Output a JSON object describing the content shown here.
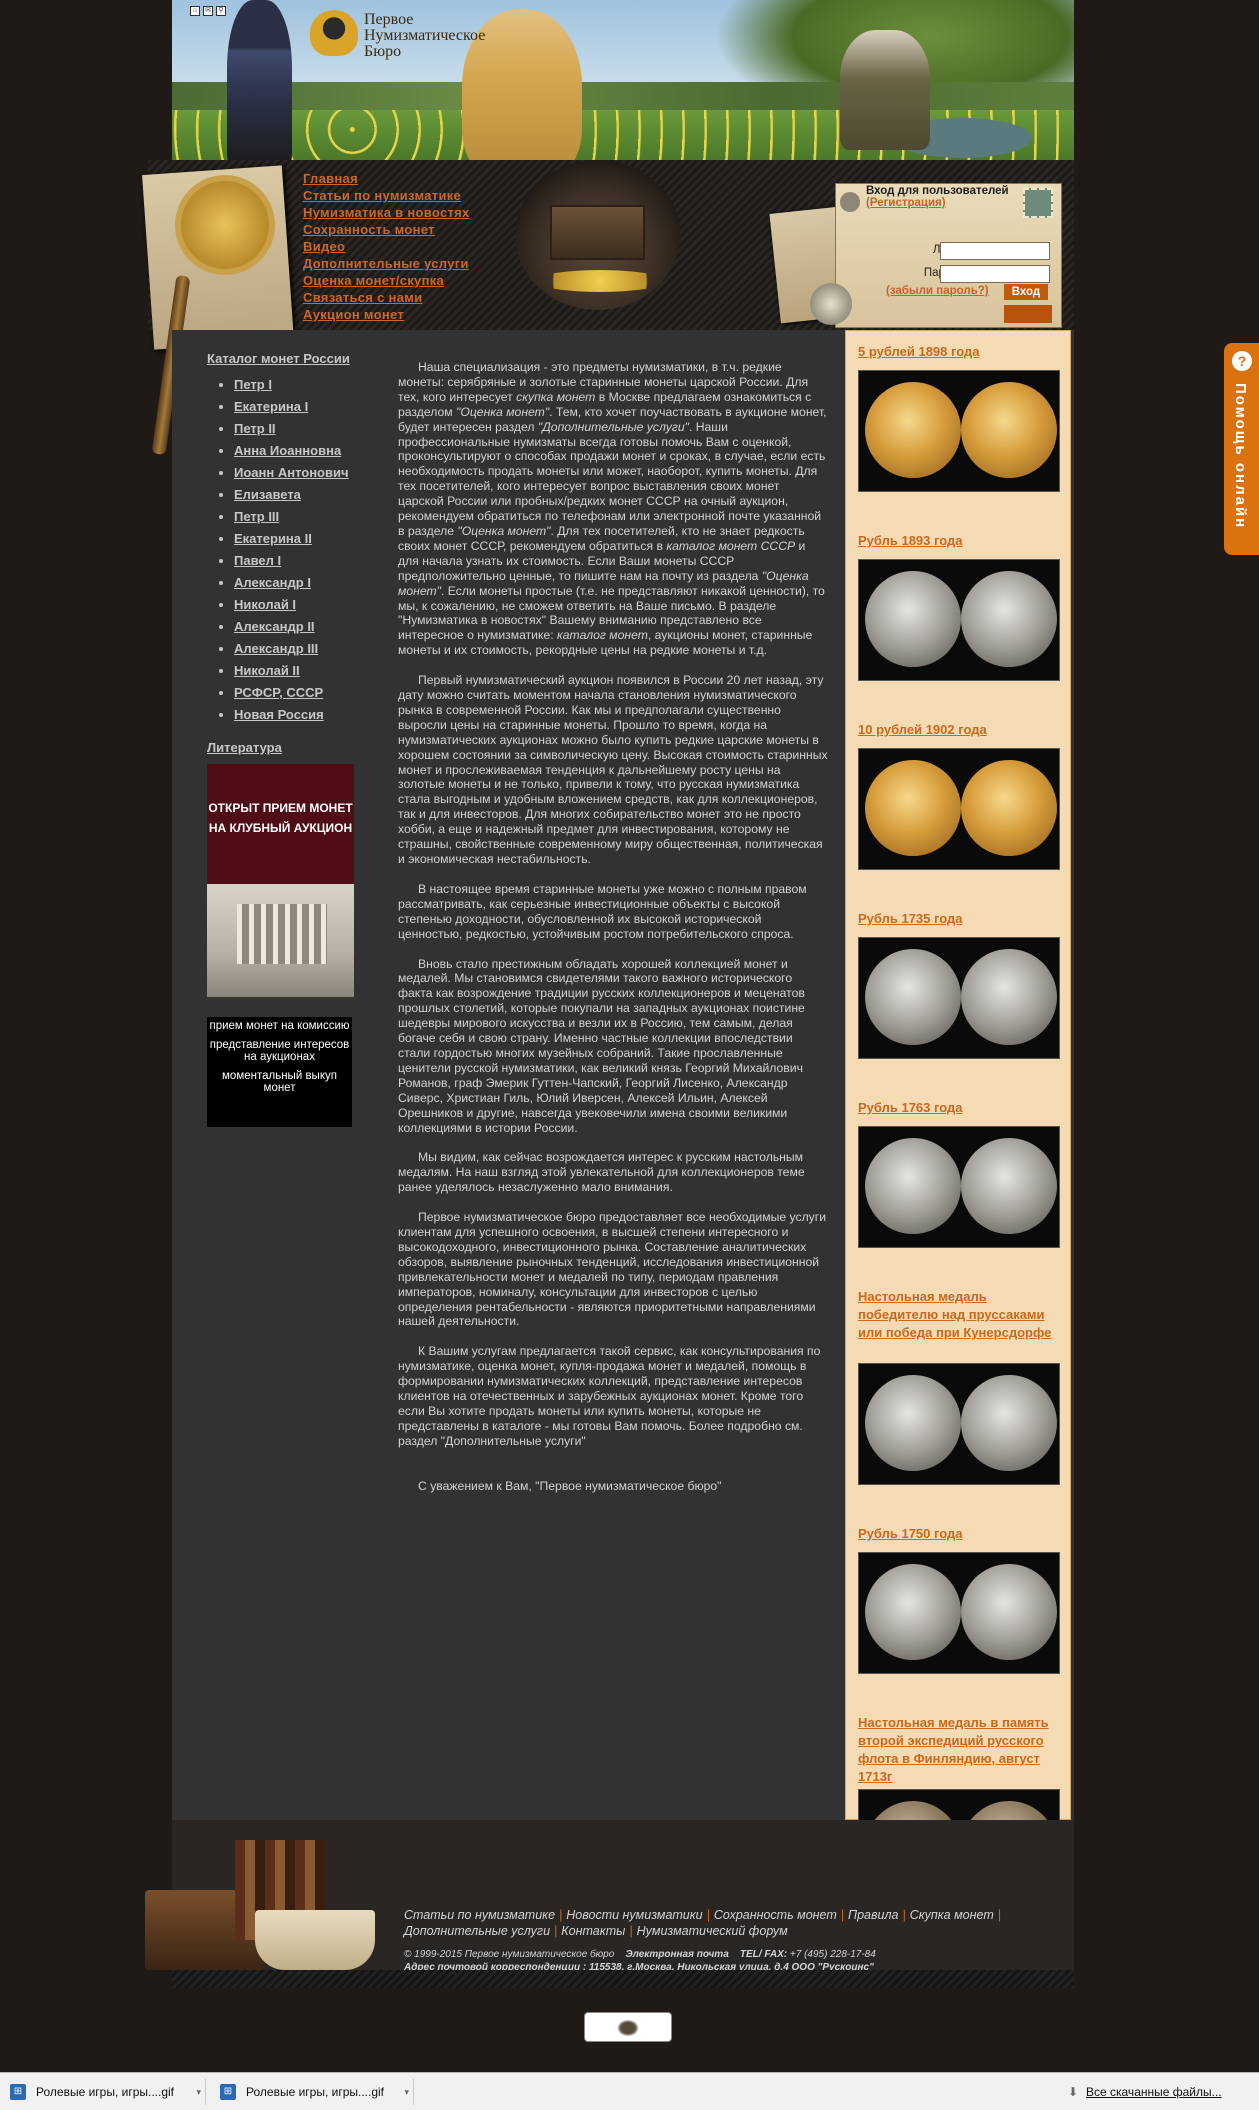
{
  "header": {
    "logo_text": "Первое\nНумизматическое\nБюро",
    "icons": [
      "home-icon",
      "mail-icon",
      "search-icon"
    ]
  },
  "nav": [
    "Главная",
    "Статьи по нумизматике",
    "Нумизматика в новостях",
    "Сохранность монет",
    "Видео",
    "Дополнительные услуги",
    "Оценка монет/скупка",
    "Связаться с нами",
    "Аукцион монет"
  ],
  "login": {
    "title": "Вход для пользователей",
    "register": "(Регистрация)",
    "login_label": "Логин:",
    "password_label": "Пароль:",
    "forgot": "(забыли пароль?)",
    "submit": "Вход"
  },
  "sidebar": {
    "catalog_title": "Каталог монет России",
    "rulers": [
      "Петр I",
      "Екатерина I",
      "Петр II",
      "Анна Иоанновна",
      "Иоанн Антонович",
      "Елизавета",
      "Петр III",
      "Екатерина II",
      "Павел I",
      "Александр I",
      "Николай I",
      "Александр II",
      "Александр III",
      "Николай II",
      "РСФСР, СССР",
      "Новая Россия"
    ],
    "literature": "Литература",
    "banner1": "ОТКРЫТ ПРИЕМ МОНЕТ\nНА КЛУБНЫЙ АУКЦИОН",
    "banner2": [
      "прием монет на комиссию",
      "представление интересов на аукционах",
      "моментальный выкуп монет"
    ]
  },
  "main": {
    "p1_a": "Наша специализация - это предметы нумизматики, в т.ч. редкие монеты: серябряные и золотые старинные монеты царской России. Для тех, кого интересует ",
    "p1_em1": "скупка монет",
    "p1_b": " в Москве предлагаем ознакомиться с разделом ",
    "p1_em2": "\"Оценка монет\"",
    "p1_c": ". Тем, кто хочет поучаствовать в аукционе монет, будет интересен раздел ",
    "p1_em3": "\"Дополнительные услуги\"",
    "p1_d": ". Наши профессиональные нумизматы всегда готовы помочь Вам с оценкой, проконсультируют о способах продажи монет и сроках, в случае, если есть необходимость продать монеты или может, наоборот, купить монеты. Для тех посетителей, кого интересует вопрос выставления своих монет царской России или пробных/редких монет СССР на очный аукцион, рекомендуем обратиться по телефонам или электронной почте указанной в разделе ",
    "p1_em4": "\"Оценка монет\"",
    "p1_e": ". Для тех посетителей, кто не знает редкость своих монет СССР, рекомендуем обратиться в ",
    "p1_em5": "каталог монет СССР",
    "p1_f": " и для начала узнать их стоимость. Если Ваши монеты СССР предположительно ценные, то пишите нам на почту из раздела ",
    "p1_em6": "\"Оценка монет\"",
    "p1_g": ". Если монеты простые (т.е. не представляют никакой ценности), то мы, к сожалению, не сможем ответить на Ваше письмо. В разделе \"Нумизматика в новостях\" Вашему вниманию представлено все интересное о нумизматике: ",
    "p1_em7": "каталог монет",
    "p1_h": ", аукционы монет, старинные монеты и их стоимость, рекордные цены на редкие монеты и т.д.",
    "p2": "Первый нумизматический аукцион появился в России 20 лет назад, эту дату можно считать моментом начала становления нумизматического рынка в современной России. Как мы и предполагали существенно выросли цены на старинные монеты. Прошло то время, когда на нумизматических аукционах можно было купить редкие царские монеты в хорошем состоянии за символическую цену. Высокая стоимость старинных монет и прослеживаемая тенденция к дальнейшему росту цены на золотые монеты и не только, привели к тому, что русская нумизматика стала выгодным и удобным вложением средств, как для коллекционеров, так и для инвесторов. Для многих собирательство монет это не просто хобби, а еще и надежный предмет для инвестирования, которому не страшны, свойственные современному миру общественная, политическая и экономическая нестабильность.",
    "p3": "В настоящее время старинные монеты уже можно с полным правом рассматривать, как серьезные инвестиционные объекты с высокой степенью доходности, обусловленной их высокой исторической ценностью, редкостью, устойчивым ростом потребительского спроса.",
    "p4": "Вновь стало престижным обладать хорошей коллекцией монет и медалей. Мы становимся свидетелями такого важного исторического факта как возрождение традиции русских коллекционеров и меценатов прошлых столетий, которые покупали на западных аукционах поистине шедевры мирового искусства и везли их в Россию, тем самым, делая богаче себя и свою страну. Именно частные коллекции впоследствии стали гордостью многих музейных собраний. Такие прославленные ценители русской нумизматики, как великий князь Георгий Михайлович Романов, граф Эмерик Гуттен-Чапский, Георгий Лисенко, Александр Сиверс, Христиан Гиль, Юлий Иверсен, Алексей Ильин, Алексей Орешников и другие, навсегда увековечили имена своими великими коллекциями в истории России.",
    "p5": "Мы видим, как сейчас возрождается интерес к русским настольным медалям. На наш взгляд этой увлекательной для коллекционеров теме ранее уделялось незаслуженно мало внимания.",
    "p6": "Первое нумизматическое бюро предоставляет все необходимые услуги клиентам для успешного освоения, в высшей степени интересного и высокодоходного, инвестиционного рынка. Составление аналитических обзоров, выявление рыночных тенденций, исследования инвестиционной привлекательности монет и медалей по типу, периодам правления императоров, номиналу, консультации для инвесторов с целью определения рентабельности - являются приоритетными направлениями нашей деятельности.",
    "p7": "К Вашим услугам предлагается такой сервис, как консультирования по нумизматике, оценка монет, купля-продажа монет и медалей, помощь в формировании нумизматических коллекций, представление интересов клиентов на отечественных и зарубежных аукционах монет. Кроме того если Вы хотите продать монеты или купить монеты, которые не представлены в каталоге - мы готовы Вам помочь. Более подробно см. раздел \"Дополнительные услуги\"",
    "p8": "С уважением к Вам, \"Первое нумизматическое бюро\""
  },
  "coins": [
    {
      "title": "5 рублей 1898 года",
      "metal": "gold"
    },
    {
      "title": "Рубль 1893 года",
      "metal": "silver"
    },
    {
      "title": "10 рублей 1902 года",
      "metal": "gold"
    },
    {
      "title": "Рубль 1735 года",
      "metal": "silver"
    },
    {
      "title": "Рубль 1763 года",
      "metal": "silver"
    },
    {
      "title": "Настольная медаль победителю над пруссаками или победа при Кунерсдорфе",
      "metal": "silver"
    },
    {
      "title": "Рубль 1750 года",
      "metal": "silver"
    },
    {
      "title": "Настольная медаль в память второй экспедиций русского флота в Финляндию, август 1713г",
      "metal": "bronze"
    }
  ],
  "footer": {
    "links": [
      "Статьи по нумизматике",
      "Новости нумизматики",
      "Сохранность монет",
      "Правила",
      "Скупка монет",
      "Дополнительные услуги",
      "Контакты",
      "Нумизматический форум"
    ],
    "copyright": "© 1999-2015 Первое нумизматическое бюро",
    "email_label": "Электронная почта",
    "tel_label": "TEL/ FAX:",
    "tel": "+7 (495) 228-17-84",
    "address_label": "Адрес почтовой корреспонденции :",
    "address": "115538, г.Москва, Никольская улица, д.4 ООО \"Рускоинс\""
  },
  "help": {
    "label": "Помощь онлайн"
  },
  "downloads": {
    "items": [
      "Ролевые игры, игры....gif",
      "Ролевые игры, игры....gif"
    ],
    "all": "Все скачанные файлы..."
  }
}
